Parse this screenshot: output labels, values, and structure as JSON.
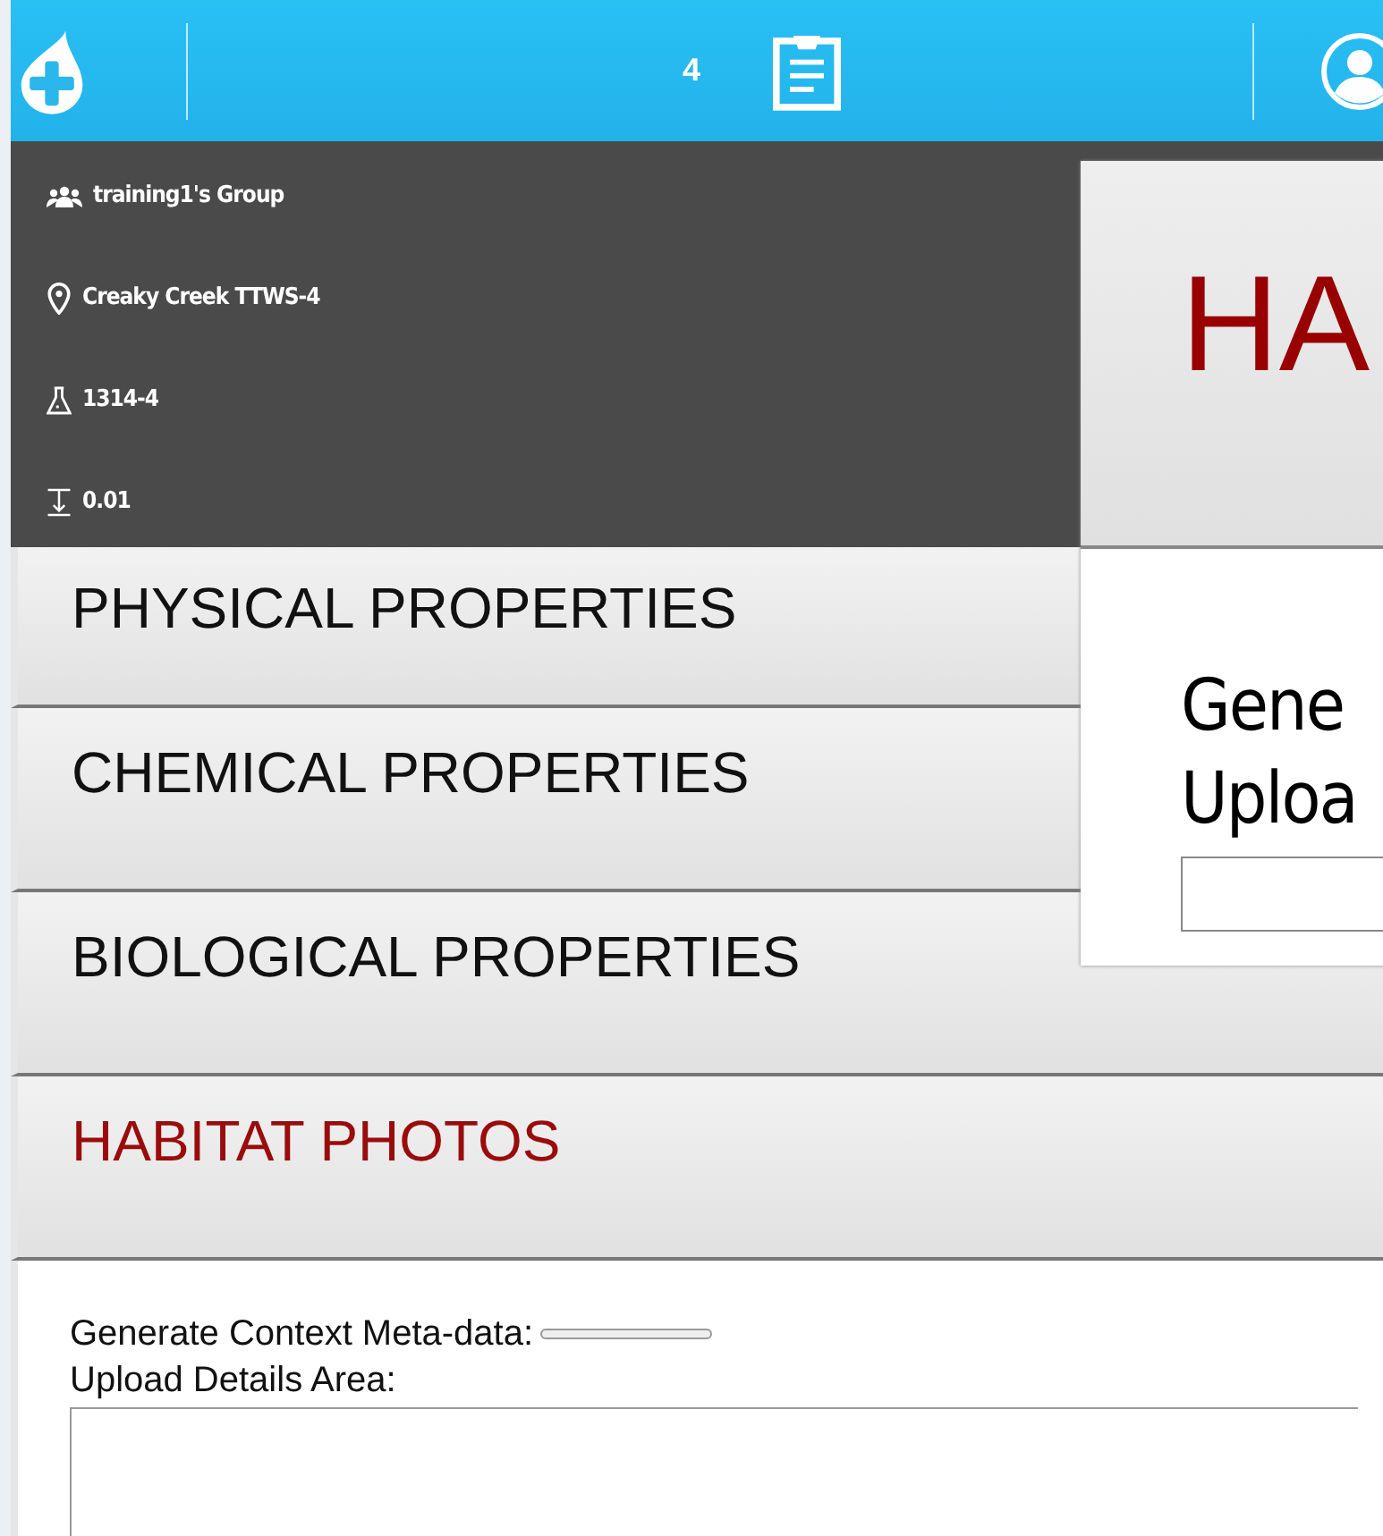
{
  "top_bar": {
    "count": "4"
  },
  "info_panel": {
    "items": [
      {
        "kind": "group",
        "text": "training1's Group"
      },
      {
        "kind": "location",
        "text": "Creaky Creek TTWS-4"
      },
      {
        "kind": "sample",
        "text": "1314-4"
      },
      {
        "kind": "depth",
        "text": "0.01"
      }
    ]
  },
  "sections": [
    {
      "label": "PHYSICAL PROPERTIES",
      "selected": false
    },
    {
      "label": "CHEMICAL PROPERTIES",
      "selected": false
    },
    {
      "label": "BIOLOGICAL PROPERTIES",
      "selected": false
    },
    {
      "label": "HABITAT PHOTOS",
      "selected": true
    }
  ],
  "habitat_content": {
    "generate_label": "Generate Context Meta-data:",
    "upload_label": "Upload Details Area:"
  },
  "overlay": {
    "title": "HA",
    "generate_label": "Gene",
    "upload_label": "Uploa"
  }
}
